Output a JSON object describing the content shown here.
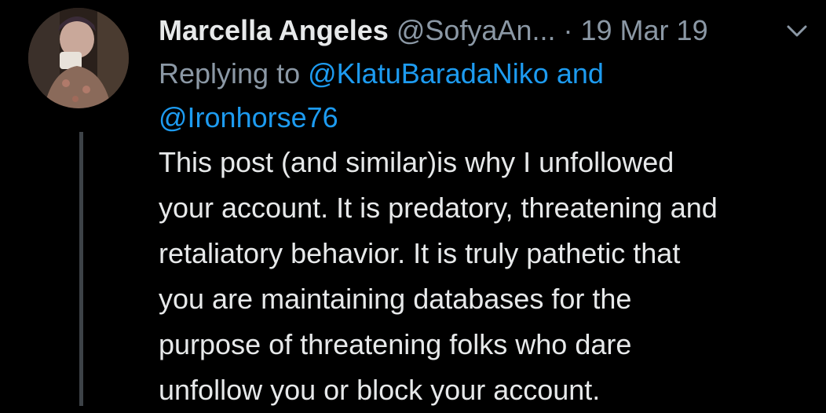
{
  "colors": {
    "background": "#000000",
    "text": "#e7e9ea",
    "muted": "#8b98a5",
    "link": "#1d9bf0",
    "thread_line": "#3d4247"
  },
  "tweet": {
    "author_name": "Marcella Angeles",
    "author_handle": "@SofyaAn...",
    "separator": "·",
    "date": "19 Mar 19",
    "menu_icon": "chevron-down-icon",
    "avatar_icon": "avatar",
    "reply": {
      "prefix": "Replying to",
      "mention_1": "@KlatuBaradaNiko",
      "joiner": "and",
      "mention_2": "@Ironhorse76"
    },
    "body_lines": [
      "This post (and similar)is why I unfollowed",
      "your account. It is predatory, threatening and",
      "retaliatory behavior. It is truly pathetic that",
      "you are maintaining databases for the",
      "purpose of threatening folks who dare",
      "unfollow you or block your account."
    ]
  }
}
